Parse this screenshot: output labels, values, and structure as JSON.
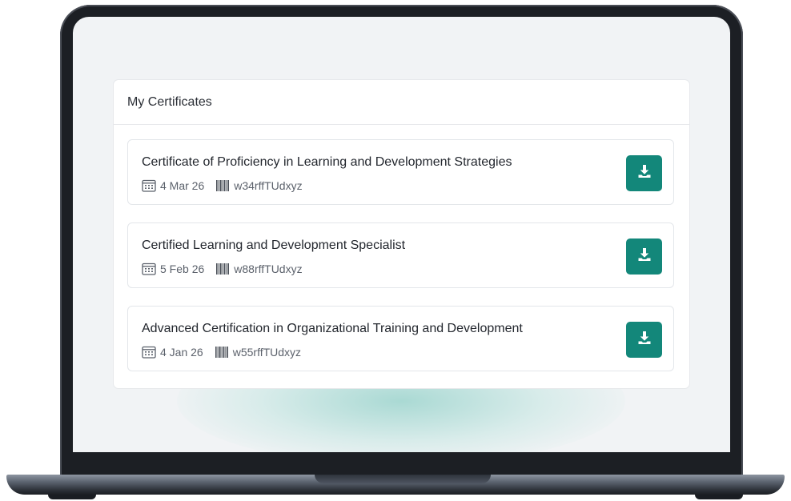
{
  "panel": {
    "title": "My Certificates"
  },
  "certificates": [
    {
      "title": "Certificate of Proficiency in Learning and Development Strategies",
      "date": "4 Mar 26",
      "code": "w34rffTUdxyz"
    },
    {
      "title": "Certified Learning and Development Specialist",
      "date": "5 Feb 26",
      "code": "w88rffTUdxyz"
    },
    {
      "title": "Advanced Certification in Organizational Training and Development",
      "date": "4 Jan 26",
      "code": "w55rffTUdxyz"
    }
  ],
  "icons": {
    "date": "calendar-icon",
    "code": "barcode-icon",
    "action": "download-icon"
  },
  "colors": {
    "accent": "#13877a",
    "screen_background": "#f1f3f5",
    "glow": "#a6ddd5"
  }
}
